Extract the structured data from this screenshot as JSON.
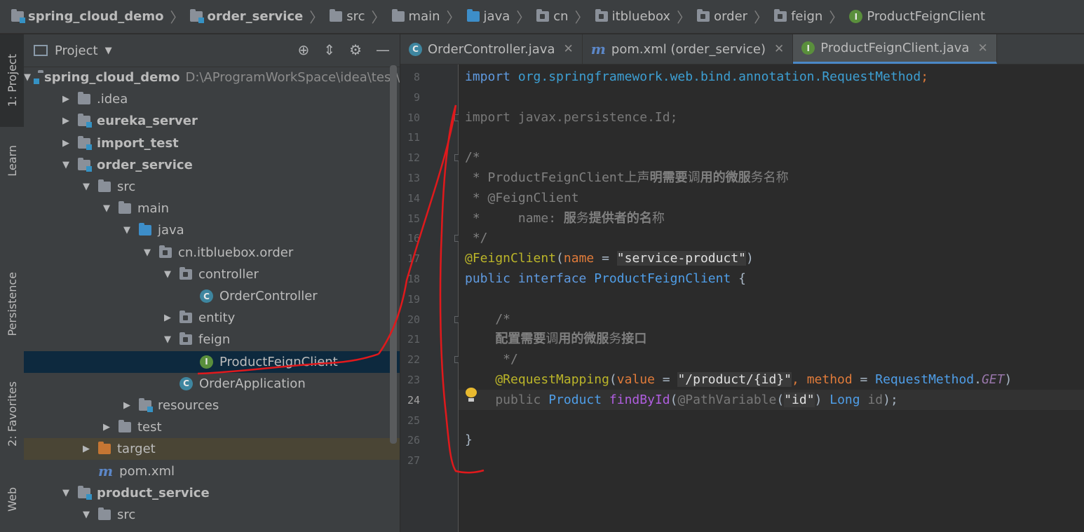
{
  "breadcrumb": [
    {
      "label": "spring_cloud_demo",
      "bold": true,
      "icon": "module-folder"
    },
    {
      "label": "order_service",
      "bold": true,
      "icon": "module-folder"
    },
    {
      "label": "src",
      "icon": "folder"
    },
    {
      "label": "main",
      "icon": "folder"
    },
    {
      "label": "java",
      "icon": "source-folder"
    },
    {
      "label": "cn",
      "icon": "package"
    },
    {
      "label": "itbluebox",
      "icon": "package"
    },
    {
      "label": "order",
      "icon": "package"
    },
    {
      "label": "feign",
      "icon": "package"
    },
    {
      "label": "ProductFeignClient",
      "icon": "interface"
    }
  ],
  "tool_strip": {
    "project": "1: Project",
    "learn": "Learn",
    "persistence": "Persistence",
    "favorites": "2: Favorites",
    "web": "Web"
  },
  "project_panel": {
    "title": "Project",
    "tree": [
      {
        "label": "spring_cloud_demo",
        "path": "D:\\AProgramWorkSpace\\idea\\test\\sp",
        "depth": 0,
        "expanded": true,
        "bold": true,
        "icon": "module-folder"
      },
      {
        "label": ".idea",
        "depth": 1,
        "expanded": false,
        "icon": "folder"
      },
      {
        "label": "eureka_server",
        "depth": 1,
        "expanded": false,
        "bold": true,
        "icon": "module-folder"
      },
      {
        "label": "import_test",
        "depth": 1,
        "expanded": false,
        "bold": true,
        "icon": "module-folder"
      },
      {
        "label": "order_service",
        "depth": 1,
        "expanded": true,
        "bold": true,
        "icon": "module-folder"
      },
      {
        "label": "src",
        "depth": 2,
        "expanded": true,
        "icon": "folder"
      },
      {
        "label": "main",
        "depth": 3,
        "expanded": true,
        "icon": "folder"
      },
      {
        "label": "java",
        "depth": 4,
        "expanded": true,
        "icon": "source-folder"
      },
      {
        "label": "cn.itbluebox.order",
        "depth": 5,
        "expanded": true,
        "icon": "package"
      },
      {
        "label": "controller",
        "depth": 6,
        "expanded": true,
        "icon": "package"
      },
      {
        "label": "OrderController",
        "depth": 7,
        "icon": "class"
      },
      {
        "label": "entity",
        "depth": 6,
        "expanded": false,
        "icon": "package"
      },
      {
        "label": "feign",
        "depth": 6,
        "expanded": true,
        "icon": "package"
      },
      {
        "label": "ProductFeignClient",
        "depth": 7,
        "icon": "interface",
        "selected": true
      },
      {
        "label": "OrderApplication",
        "depth": 6,
        "icon": "spring-class"
      },
      {
        "label": "resources",
        "depth": 4,
        "expanded": false,
        "icon": "resources-folder"
      },
      {
        "label": "test",
        "depth": 3,
        "expanded": false,
        "icon": "folder"
      },
      {
        "label": "target",
        "depth": 2,
        "expanded": false,
        "icon": "excluded-folder",
        "excluded": true
      },
      {
        "label": "pom.xml",
        "depth": 2,
        "icon": "maven"
      },
      {
        "label": "product_service",
        "depth": 1,
        "expanded": true,
        "bold": true,
        "icon": "module-folder"
      },
      {
        "label": "src",
        "depth": 2,
        "expanded": true,
        "icon": "folder"
      }
    ]
  },
  "editor_tabs": [
    {
      "label": "OrderController.java",
      "icon": "class",
      "active": false
    },
    {
      "label": "pom.xml (order_service)",
      "icon": "maven",
      "active": false
    },
    {
      "label": "ProductFeignClient.java",
      "icon": "interface",
      "active": true
    }
  ],
  "code": {
    "current_line": 24,
    "lines": [
      {
        "n": 8,
        "tokens": [
          [
            "kw",
            "import "
          ],
          [
            "pkg",
            "org.springframework.web.bind.annotation.RequestMethod"
          ],
          [
            "prm",
            ";"
          ]
        ]
      },
      {
        "n": 9,
        "tokens": []
      },
      {
        "n": 10,
        "tokens": [
          [
            "gray",
            "import javax.persistence.Id;"
          ]
        ]
      },
      {
        "n": 11,
        "tokens": []
      },
      {
        "n": 12,
        "tokens": [
          [
            "cm",
            "/*"
          ]
        ]
      },
      {
        "n": 13,
        "tokens": [
          [
            "cm",
            " * ProductFeignClient上声"
          ],
          [
            "cmb",
            "明需要"
          ],
          [
            "cm",
            "调"
          ],
          [
            "cmb",
            "用的微服"
          ],
          [
            "cm",
            "务名称"
          ]
        ]
      },
      {
        "n": 14,
        "tokens": [
          [
            "cm",
            " * @FeignClient"
          ]
        ]
      },
      {
        "n": 15,
        "tokens": [
          [
            "cm",
            " *     name: "
          ],
          [
            "cmb",
            "服"
          ],
          [
            "cm",
            "务"
          ],
          [
            "cmb",
            "提供者的名"
          ],
          [
            "cm",
            "称"
          ]
        ]
      },
      {
        "n": 16,
        "tokens": [
          [
            "cm",
            " */"
          ]
        ]
      },
      {
        "n": 17,
        "tokens": [
          [
            "ann",
            "@FeignClient"
          ],
          [
            "",
            "("
          ],
          [
            "prm",
            "name"
          ],
          [
            "",
            " = "
          ],
          [
            "str",
            "\"service-product\""
          ],
          [
            "",
            ")"
          ]
        ]
      },
      {
        "n": 18,
        "tokens": [
          [
            "kw",
            "public interface "
          ],
          [
            "type",
            "ProductFeignClient"
          ],
          [
            "",
            " {"
          ]
        ]
      },
      {
        "n": 19,
        "tokens": []
      },
      {
        "n": 20,
        "tokens": [
          [
            "cm",
            "    /*"
          ]
        ]
      },
      {
        "n": 21,
        "tokens": [
          [
            "cmb",
            "    配置需要"
          ],
          [
            "cm",
            "调"
          ],
          [
            "cmb",
            "用的微服"
          ],
          [
            "cm",
            "务"
          ],
          [
            "cmb",
            "接口"
          ]
        ]
      },
      {
        "n": 22,
        "tokens": [
          [
            "cm",
            "     */"
          ]
        ]
      },
      {
        "n": 23,
        "tokens": [
          [
            "ann",
            "    @RequestMapping"
          ],
          [
            "",
            "("
          ],
          [
            "prm",
            "value"
          ],
          [
            "",
            " = "
          ],
          [
            "str",
            "\"/product/{id}\""
          ],
          [
            "prm",
            ", method"
          ],
          [
            "",
            " = "
          ],
          [
            "type",
            "RequestMethod"
          ],
          [
            "",
            "."
          ],
          [
            "italic",
            "GET"
          ],
          [
            "",
            ")"
          ]
        ]
      },
      {
        "n": 24,
        "tokens": [
          [
            "gray",
            "    public "
          ],
          [
            "type",
            "Product "
          ],
          [
            "mth",
            "findById"
          ],
          [
            "",
            "("
          ],
          [
            "gray",
            "@PathVariable"
          ],
          [
            "",
            "("
          ],
          [
            "str",
            "\"id\""
          ],
          [
            "",
            ") "
          ],
          [
            "type",
            "Long "
          ],
          [
            "gray",
            "id"
          ],
          [
            "",
            ");"
          ]
        ]
      },
      {
        "n": 25,
        "tokens": []
      },
      {
        "n": 26,
        "tokens": [
          [
            "",
            "}"
          ]
        ]
      },
      {
        "n": 27,
        "tokens": []
      }
    ]
  },
  "colors": {
    "editor_bg": "#2b2b2b",
    "panel_bg": "#3c3f41",
    "selection": "#0d293e",
    "annotation_stroke": "#e0191c"
  }
}
